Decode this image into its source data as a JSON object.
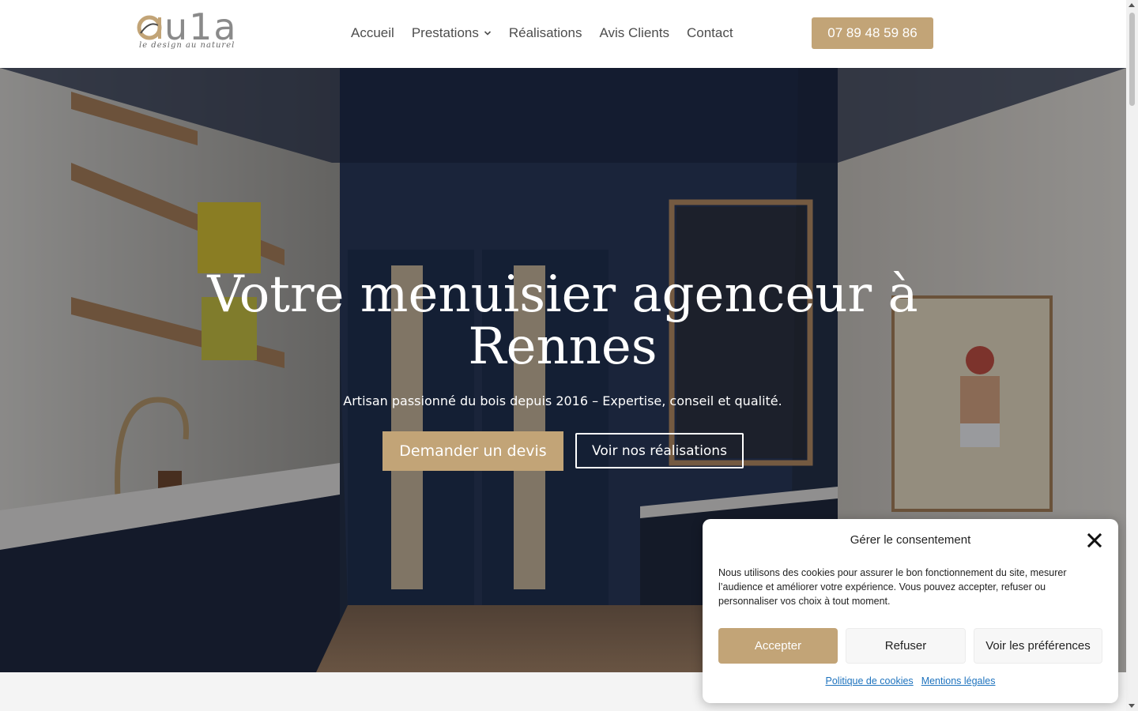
{
  "header": {
    "logo": {
      "word": "u1a",
      "tagline": "le design au naturel"
    },
    "nav": [
      {
        "label": "Accueil"
      },
      {
        "label": "Prestations",
        "has_dropdown": true
      },
      {
        "label": "Réalisations"
      },
      {
        "label": "Avis Clients"
      },
      {
        "label": "Contact"
      }
    ],
    "phone": "07 89 48 59 86"
  },
  "hero": {
    "title": "Votre menuisier agenceur à Rennes",
    "subtitle": "Artisan passionné du bois depuis 2016 – Expertise, conseil et qualité.",
    "primary_cta": "Demander un devis",
    "secondary_cta": "Voir nos réalisations"
  },
  "cookie_banner": {
    "title": "Gérer le consentement",
    "text": "Nous utilisons des cookies pour assurer le bon fonctionnement du site, mesurer l’audience et améliorer votre expérience. Vous pouvez accepter, refuser ou personnaliser vos choix à tout moment.",
    "accept": "Accepter",
    "refuse": "Refuser",
    "preferences": "Voir les préférences",
    "links": [
      "Politique de cookies",
      "Mentions légales"
    ]
  },
  "colors": {
    "accent": "#c2a477",
    "nav_text": "#4d4d4d",
    "link": "#1e73be"
  },
  "icons": [
    "chevron-down-icon",
    "close-icon",
    "logo-a-icon"
  ]
}
